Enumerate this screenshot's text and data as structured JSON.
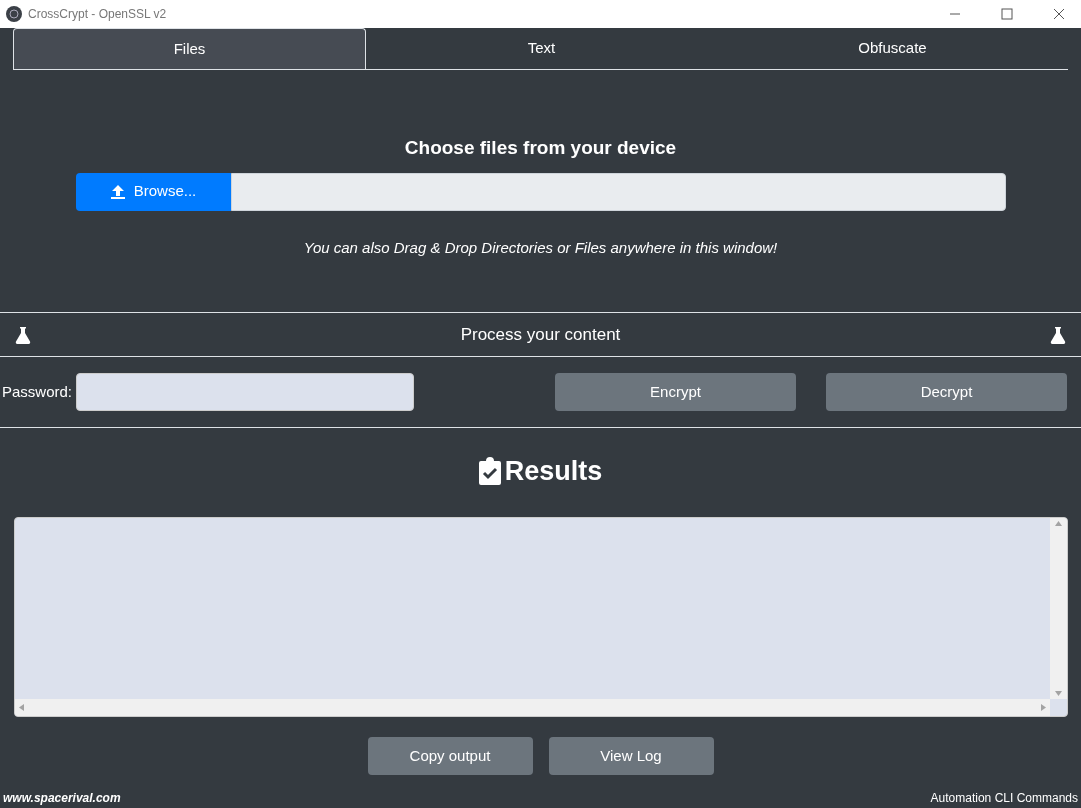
{
  "window": {
    "title": "CrossCrypt - OpenSSL v2"
  },
  "tabs": [
    {
      "label": "Files",
      "selected": true
    },
    {
      "label": "Text",
      "selected": false
    },
    {
      "label": "Obfuscate",
      "selected": false
    }
  ],
  "files": {
    "heading": "Choose files from your device",
    "browse_button": "Browse...",
    "hint": "You can also Drag & Drop Directories or Files anywhere in this window!"
  },
  "process": {
    "heading": "Process your content",
    "password_label": "Password:",
    "buttons": [
      "Encrypt",
      "Decrypt"
    ]
  },
  "results": {
    "heading": "Results",
    "buttons": [
      "Copy output",
      "View Log"
    ]
  },
  "footer": {
    "left": "www.spacerival.com",
    "right": "Automation CLI Commands"
  }
}
